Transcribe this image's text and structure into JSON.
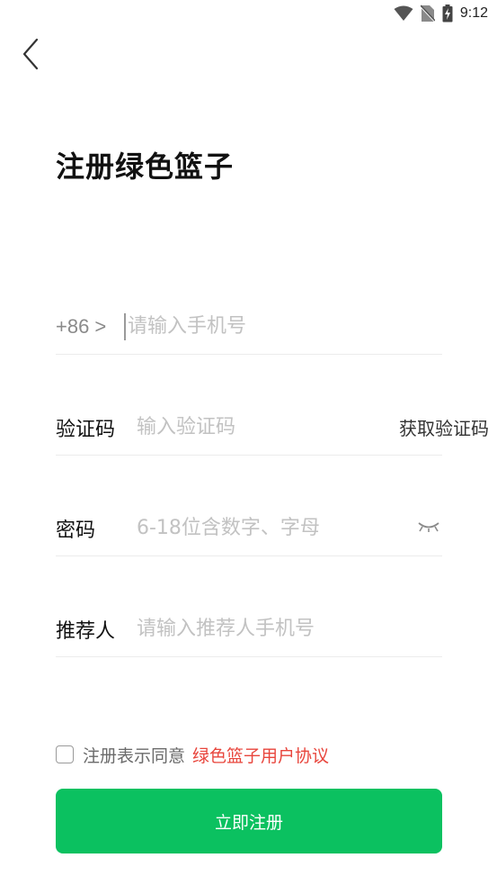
{
  "status_bar": {
    "time": "9:12",
    "icons": [
      "wifi-icon",
      "no-sim-icon",
      "battery-charging-icon"
    ]
  },
  "header": {
    "back_icon": "chevron-left-icon"
  },
  "page": {
    "title": "注册绿色篮子"
  },
  "form": {
    "phone": {
      "country_code": "+86 >",
      "placeholder": "请输入手机号",
      "value": ""
    },
    "code": {
      "label": "验证码",
      "placeholder": "输入验证码",
      "value": "",
      "get_code_label": "获取验证码"
    },
    "password": {
      "label": "密码",
      "placeholder": "6-18位含数字、字母",
      "value": "",
      "toggle_icon": "eye-closed-icon"
    },
    "referrer": {
      "label": "推荐人",
      "placeholder": "请输入推荐人手机号",
      "value": ""
    }
  },
  "agreement": {
    "checked": false,
    "text": "注册表示同意",
    "link_text": "绿色篮子用户协议"
  },
  "actions": {
    "register_label": "立即注册"
  },
  "colors": {
    "primary": "#0bc160",
    "link": "#e8453c",
    "placeholder": "#c2c2c2",
    "divider": "#ececec"
  }
}
